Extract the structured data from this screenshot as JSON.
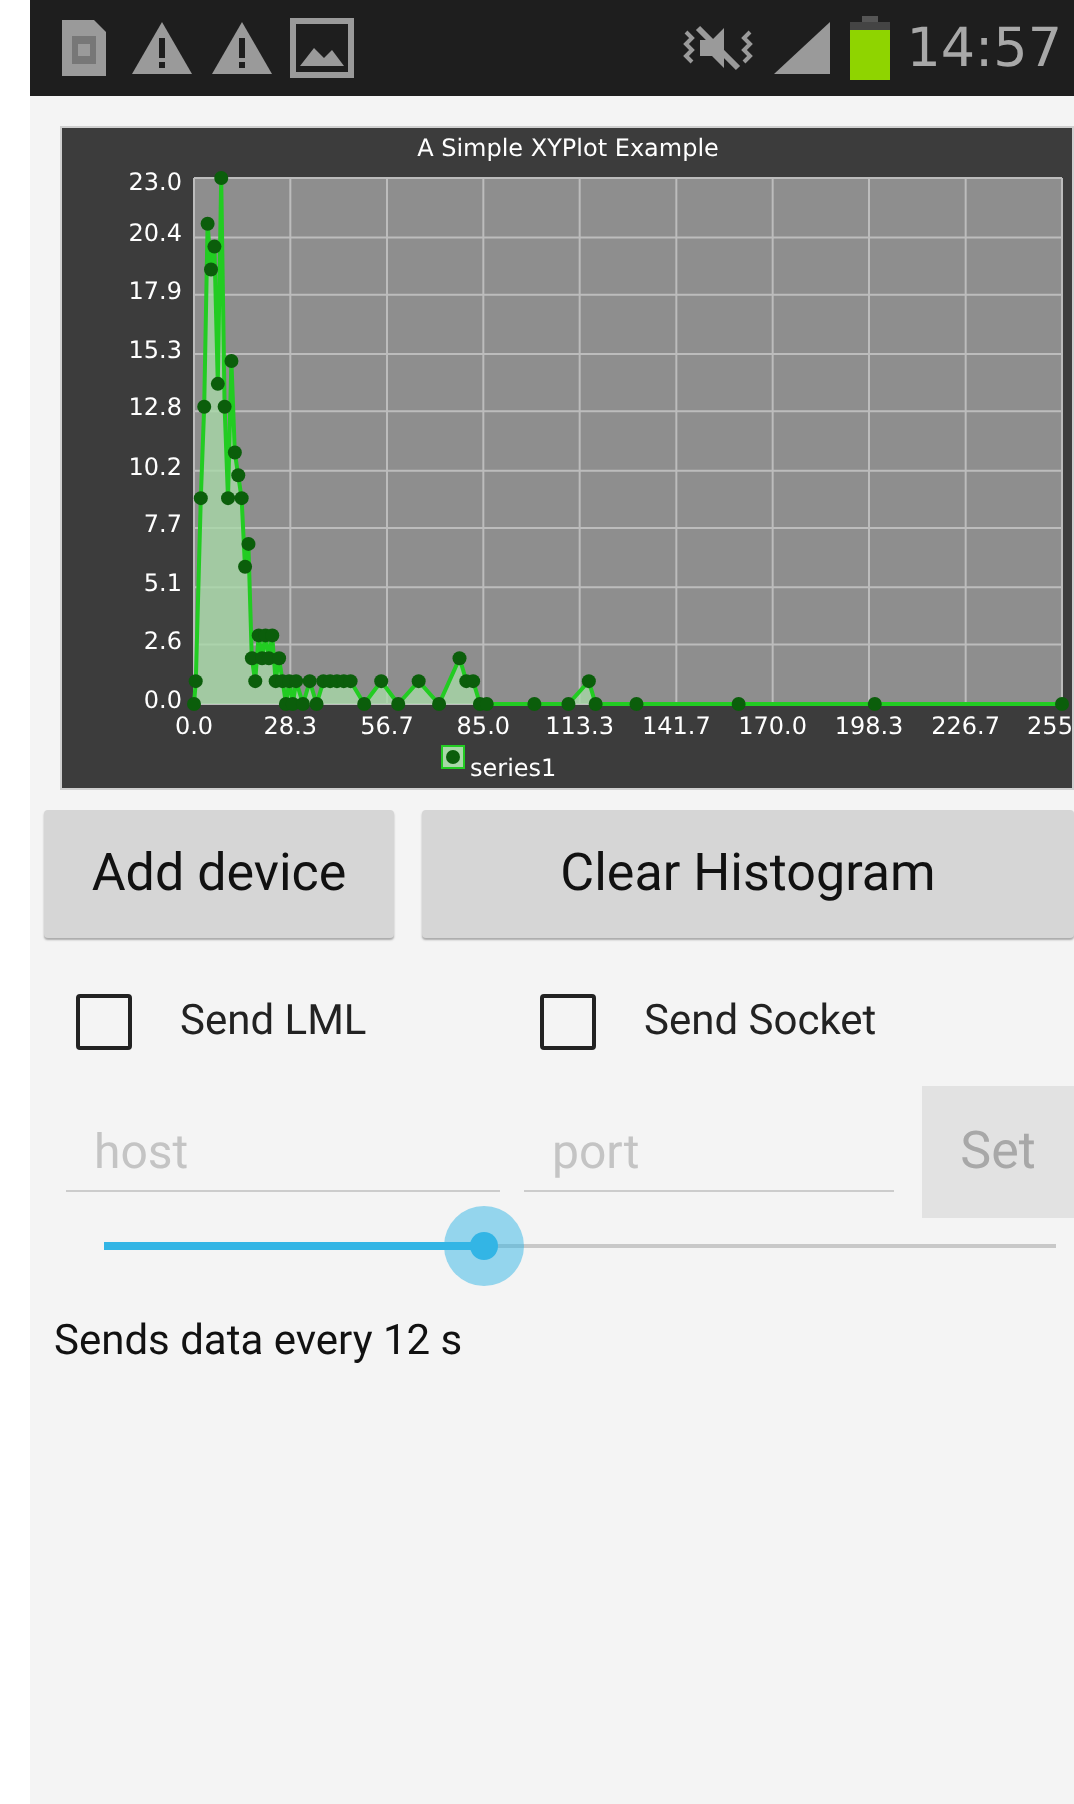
{
  "status_bar": {
    "time": "14:57"
  },
  "chart": {
    "chart_data": {
      "type": "line",
      "title": "A Simple XYPlot Example",
      "grid": true,
      "x": [
        0,
        0.5,
        2,
        3,
        4,
        5,
        6,
        7,
        8,
        9,
        10,
        11,
        12,
        13,
        14,
        15,
        16,
        17,
        18,
        19,
        20,
        21,
        22,
        23,
        24,
        25,
        26,
        27,
        28,
        29,
        30,
        32,
        34,
        36,
        38,
        40,
        42,
        44,
        46,
        50,
        55,
        60,
        66,
        72,
        78,
        80,
        82,
        84,
        86,
        100,
        110,
        116,
        118,
        130,
        160,
        200,
        255
      ],
      "series": [
        {
          "name": "series1",
          "color": "#22cc22",
          "marker": "circle",
          "values": [
            0,
            1,
            9,
            13,
            21,
            19,
            20,
            14,
            23,
            13,
            9,
            15,
            11,
            10,
            9,
            6,
            7,
            2,
            1,
            3,
            2,
            3,
            2,
            3,
            1,
            2,
            1,
            0,
            1,
            0,
            1,
            0,
            1,
            0,
            1,
            1,
            1,
            1,
            1,
            0,
            1,
            0,
            1,
            0,
            2,
            1,
            1,
            0,
            0,
            0,
            0,
            1,
            0,
            0,
            0,
            0,
            0
          ]
        }
      ],
      "xlim": [
        0,
        255
      ],
      "ylim": [
        0,
        23
      ],
      "xticks": [
        {
          "value": 0,
          "label": "0.0"
        },
        {
          "value": 28.3,
          "label": "28.3"
        },
        {
          "value": 56.7,
          "label": "56.7"
        },
        {
          "value": 85,
          "label": "85.0"
        },
        {
          "value": 113.3,
          "label": "113.3"
        },
        {
          "value": 141.7,
          "label": "141.7"
        },
        {
          "value": 170,
          "label": "170.0"
        },
        {
          "value": 198.3,
          "label": "198.3"
        },
        {
          "value": 226.7,
          "label": "226.7"
        },
        {
          "value": 255,
          "label": "255"
        }
      ],
      "yticks": [
        {
          "value": 0,
          "label": "0.0"
        },
        {
          "value": 2.6,
          "label": "2.6"
        },
        {
          "value": 5.1,
          "label": "5.1"
        },
        {
          "value": 7.7,
          "label": "7.7"
        },
        {
          "value": 10.2,
          "label": "10.2"
        },
        {
          "value": 12.8,
          "label": "12.8"
        },
        {
          "value": 15.3,
          "label": "15.3"
        },
        {
          "value": 17.9,
          "label": "17.9"
        },
        {
          "value": 20.4,
          "label": "20.4"
        },
        {
          "value": 23,
          "label": "23.0"
        }
      ]
    }
  },
  "buttons": [
    {
      "label": "Add device"
    },
    {
      "label": "Clear Histogram"
    }
  ],
  "checkboxes": [
    {
      "label": "Send LML",
      "checked": false
    },
    {
      "label": "Send Socket",
      "checked": false
    }
  ],
  "fields": [
    {
      "placeholder": "host"
    },
    {
      "placeholder": "port"
    }
  ],
  "set_button": {
    "label": "Set",
    "disabled": true
  },
  "slider": {
    "level": 0.4
  },
  "interval_text": "Sends data every 12 s"
}
